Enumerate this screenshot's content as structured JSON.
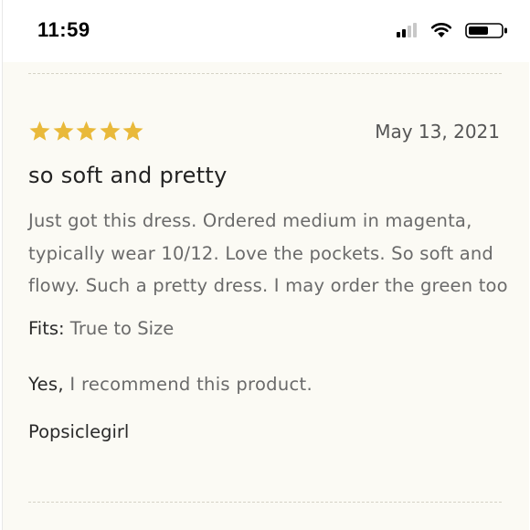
{
  "status_bar": {
    "time": "11:59",
    "signal_icon": "cellular-signal-icon",
    "wifi_icon": "wifi-icon",
    "battery_icon": "battery-icon"
  },
  "review": {
    "rating": 5,
    "rating_max": 5,
    "star_color": "#e9b93a",
    "date": "May 13, 2021",
    "title": "so soft and pretty",
    "body": "Just got this dress. Ordered medium in magenta, typically wear 10/12. Love the pockets. So soft and flowy. Such a pretty dress. I may order the green too",
    "fits_label": "Fits:",
    "fits_value": "True to Size",
    "recommend_yes": "Yes,",
    "recommend_text": "I recommend this product.",
    "author": "Popsiclegirl"
  },
  "colors": {
    "background": "#fbfaf4",
    "text_dark": "#2a2a2a",
    "text_muted": "#6a6a6a"
  }
}
